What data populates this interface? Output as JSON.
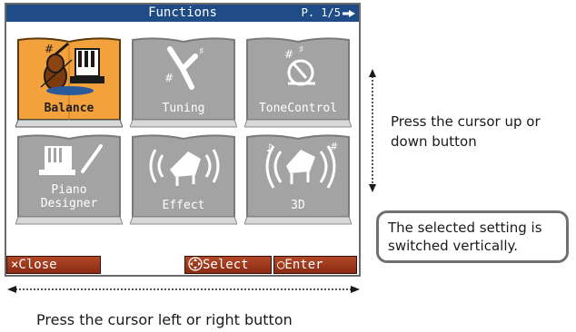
{
  "screen": {
    "title": "Functions",
    "page_indicator": "P. 1/5",
    "page_arrow_icon": "right-arrow-icon"
  },
  "tiles": [
    {
      "id": "balance",
      "label": "Balance",
      "icon": "violin-piano-icon",
      "selected": true
    },
    {
      "id": "tuning",
      "label": "Tuning",
      "icon": "tuning-fork-icon",
      "selected": false
    },
    {
      "id": "tone",
      "label": "ToneControl",
      "icon": "tone-control-icon",
      "selected": false
    },
    {
      "id": "piano-designer",
      "label_line1": "Piano",
      "label_line2": "Designer",
      "icon": "piano-designer-icon",
      "selected": false
    },
    {
      "id": "effect",
      "label": "Effect",
      "icon": "piano-effect-icon",
      "selected": false
    },
    {
      "id": "3d",
      "label": "3D",
      "icon": "grand-piano-3d-icon",
      "selected": false
    }
  ],
  "status_bar": {
    "close_label": "×Close",
    "select_label": "Select",
    "select_icon": "cursor-pad-icon",
    "enter_label": "○Enter"
  },
  "annotations": {
    "vertical_line1": "Press the cursor up or",
    "vertical_line2": "down button",
    "box_line1": "The selected setting is",
    "box_line2": "switched vertically.",
    "horizontal": "Press the cursor left or right button"
  },
  "colors": {
    "title_bar": "#1f4c86",
    "tile_gray": "#a3a3a3",
    "tile_selected": "#f2a13c",
    "button_red": "#8a2b12"
  }
}
